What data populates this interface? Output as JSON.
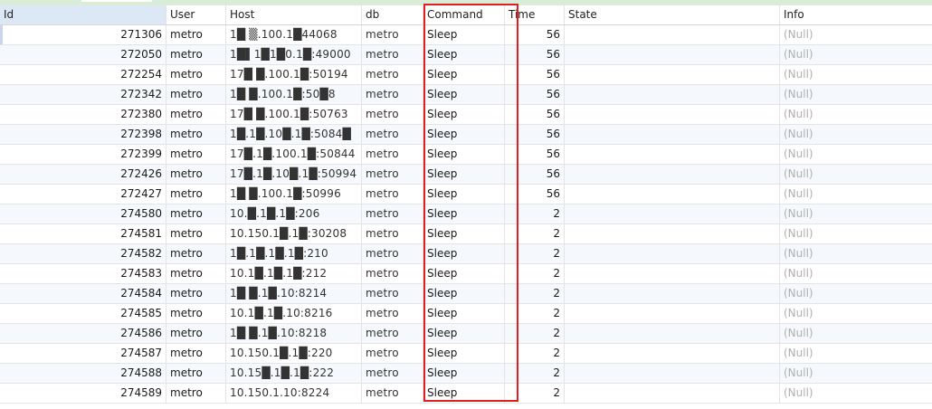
{
  "columns": {
    "id": "Id",
    "user": "User",
    "host": "Host",
    "db": "db",
    "command": "Command",
    "time": "Time",
    "state": "State",
    "info": "Info"
  },
  "rows": [
    {
      "id": "271306",
      "user": "metro",
      "host": "1█ ▒.100.1█44068",
      "db": "metro",
      "command": "Sleep",
      "time": "56",
      "state": "",
      "info": "(Null)"
    },
    {
      "id": "272050",
      "user": "metro",
      "host": "1█▌1█1█0.1█:49000",
      "db": "metro",
      "command": "Sleep",
      "time": "56",
      "state": "",
      "info": "(Null)"
    },
    {
      "id": "272254",
      "user": "metro",
      "host": "17█ █.100.1█:50194",
      "db": "metro",
      "command": "Sleep",
      "time": "56",
      "state": "",
      "info": "(Null)"
    },
    {
      "id": "272342",
      "user": "metro",
      "host": "1█ █.100.1█:50█8",
      "db": "metro",
      "command": "Sleep",
      "time": "56",
      "state": "",
      "info": "(Null)"
    },
    {
      "id": "272380",
      "user": "metro",
      "host": "17█ █.100.1█:50763",
      "db": "metro",
      "command": "Sleep",
      "time": "56",
      "state": "",
      "info": "(Null)"
    },
    {
      "id": "272398",
      "user": "metro",
      "host": "1█.1█.10█.1█:5084█",
      "db": "metro",
      "command": "Sleep",
      "time": "56",
      "state": "",
      "info": "(Null)"
    },
    {
      "id": "272399",
      "user": "metro",
      "host": "17█.1█.100.1█:50844",
      "db": "metro",
      "command": "Sleep",
      "time": "56",
      "state": "",
      "info": "(Null)"
    },
    {
      "id": "272426",
      "user": "metro",
      "host": "17█.1█.10█.1█:50994",
      "db": "metro",
      "command": "Sleep",
      "time": "56",
      "state": "",
      "info": "(Null)"
    },
    {
      "id": "272427",
      "user": "metro",
      "host": "1█ █.100.1█:50996",
      "db": "metro",
      "command": "Sleep",
      "time": "56",
      "state": "",
      "info": "(Null)"
    },
    {
      "id": "274580",
      "user": "metro",
      "host": "10.█.1█.1█:206",
      "db": "metro",
      "command": "Sleep",
      "time": "2",
      "state": "",
      "info": "(Null)"
    },
    {
      "id": "274581",
      "user": "metro",
      "host": "10.150.1█.1█:30208",
      "db": "metro",
      "command": "Sleep",
      "time": "2",
      "state": "",
      "info": "(Null)"
    },
    {
      "id": "274582",
      "user": "metro",
      "host": "1█.1█.1█.1█:210",
      "db": "metro",
      "command": "Sleep",
      "time": "2",
      "state": "",
      "info": "(Null)"
    },
    {
      "id": "274583",
      "user": "metro",
      "host": "10.1█.1█.1█:212",
      "db": "metro",
      "command": "Sleep",
      "time": "2",
      "state": "",
      "info": "(Null)"
    },
    {
      "id": "274584",
      "user": "metro",
      "host": "1█ █.1█.10:8214",
      "db": "metro",
      "command": "Sleep",
      "time": "2",
      "state": "",
      "info": "(Null)"
    },
    {
      "id": "274585",
      "user": "metro",
      "host": "10.1█.1█.10:8216",
      "db": "metro",
      "command": "Sleep",
      "time": "2",
      "state": "",
      "info": "(Null)"
    },
    {
      "id": "274586",
      "user": "metro",
      "host": "1█ █.1█.10:8218",
      "db": "metro",
      "command": "Sleep",
      "time": "2",
      "state": "",
      "info": "(Null)"
    },
    {
      "id": "274587",
      "user": "metro",
      "host": "10.150.1█.1█:220",
      "db": "metro",
      "command": "Sleep",
      "time": "2",
      "state": "",
      "info": "(Null)"
    },
    {
      "id": "274588",
      "user": "metro",
      "host": "10.15█.1█.1█:222",
      "db": "metro",
      "command": "Sleep",
      "time": "2",
      "state": "",
      "info": "(Null)"
    },
    {
      "id": "274589",
      "user": "metro",
      "host": "10.150.1.10:8224",
      "db": "metro",
      "command": "Sleep",
      "time": "2",
      "state": "",
      "info": "(Null)"
    }
  ],
  "colors": {
    "highlight_border": "#e02020",
    "header_id_bg": "#dce8f6",
    "null_text": "#b0b0b0",
    "alt_row_bg": "#f5f8fc"
  }
}
